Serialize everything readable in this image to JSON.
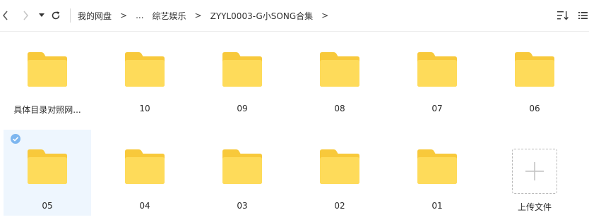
{
  "toolbar": {
    "back_icon": "chevron-left-icon",
    "forward_icon": "chevron-right-icon",
    "history_icon": "caret-down-icon",
    "refresh_icon": "refresh-icon",
    "breadcrumb": {
      "root": "我的网盘",
      "ellipsis": "...",
      "level1": "综艺娱乐",
      "level2": "ZYYL0003-G小SONG合集",
      "separator": ">"
    },
    "sort_icon": "sort-icon",
    "list_view_icon": "list-view-icon"
  },
  "items": [
    {
      "label": "具体目录对照网...",
      "type": "folder",
      "selected": false
    },
    {
      "label": "10",
      "type": "folder",
      "selected": false
    },
    {
      "label": "09",
      "type": "folder",
      "selected": false
    },
    {
      "label": "08",
      "type": "folder",
      "selected": false
    },
    {
      "label": "07",
      "type": "folder",
      "selected": false
    },
    {
      "label": "06",
      "type": "folder",
      "selected": false
    },
    {
      "label": "05",
      "type": "folder",
      "selected": true
    },
    {
      "label": "04",
      "type": "folder",
      "selected": false
    },
    {
      "label": "03",
      "type": "folder",
      "selected": false
    },
    {
      "label": "02",
      "type": "folder",
      "selected": false
    },
    {
      "label": "01",
      "type": "folder",
      "selected": false
    }
  ],
  "upload": {
    "label": "上传文件",
    "icon": "plus-icon"
  },
  "colors": {
    "folder_back": "#f8c93b",
    "folder_front": "#fedb5a",
    "selection_bg": "#eef6fe",
    "check": "#7db6ef"
  }
}
